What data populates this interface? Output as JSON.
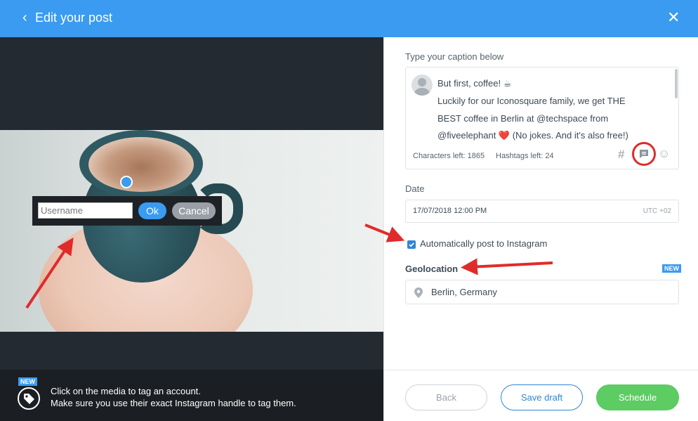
{
  "header": {
    "back_icon": "‹",
    "title": "Edit your post",
    "close_icon": "✕",
    "background": "#3a9bf0"
  },
  "media": {
    "tag_popup": {
      "input_placeholder": "Username",
      "ok_label": "Ok",
      "cancel_label": "Cancel"
    },
    "tip": {
      "badge": "NEW",
      "line1": "Click on the media to tag an account.",
      "line2": "Make sure you use their exact Instagram handle to tag them."
    }
  },
  "caption": {
    "label": "Type your caption below",
    "lines": [
      "But first, coffee! ☕",
      "Luckily for our Iconosquare family, we get THE",
      "BEST coffee in Berlin at @techspace from",
      "@fiveelephant ❤️ (No jokes. And it's also free!)"
    ],
    "characters_left": "Characters left: 1865",
    "hashtags_left": "Hashtags left: 24",
    "hashtag_icon": "#",
    "emoji_icon": "☺"
  },
  "date": {
    "label": "Date",
    "value": "17/07/2018 12:00 PM",
    "timezone": "UTC +02"
  },
  "auto_post": {
    "label": "Automatically post to Instagram",
    "checked": true
  },
  "geolocation": {
    "label": "Geolocation",
    "badge": "NEW",
    "value": "Berlin, Germany"
  },
  "footer": {
    "back_label": "Back",
    "draft_label": "Save draft",
    "schedule_label": "Schedule"
  },
  "colors": {
    "accent": "#3a9bf0",
    "schedule": "#5ccc63",
    "annotation": "#e02b2b"
  }
}
